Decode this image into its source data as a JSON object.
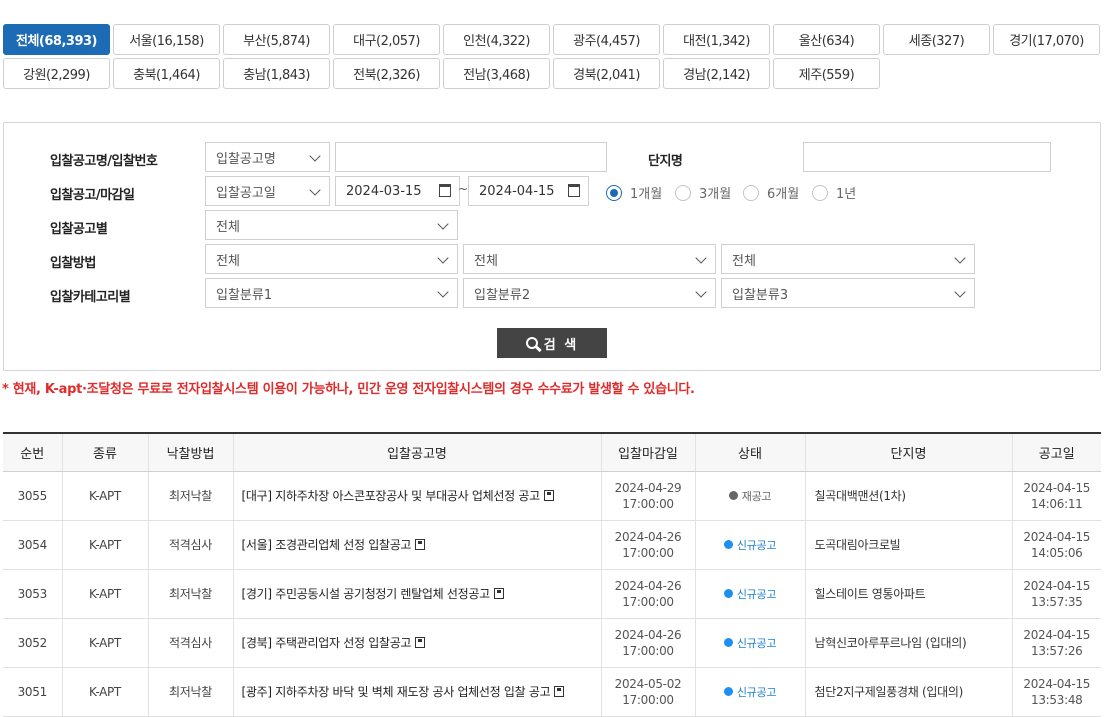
{
  "regions": [
    [
      "전체(68,393)",
      "서울(16,158)",
      "부산(5,874)",
      "대구(2,057)",
      "인천(4,322)",
      "광주(4,457)",
      "대전(1,342)",
      "울산(634)",
      "세종(327)",
      "경기(17,070)"
    ],
    [
      "강원(2,299)",
      "충북(1,464)",
      "충남(1,843)",
      "전북(2,326)",
      "전남(3,468)",
      "경북(2,041)",
      "경남(2,142)",
      "제주(559)"
    ]
  ],
  "search": {
    "label_name": "입찰공고명/입찰번호",
    "name_type": "입찰공고명",
    "label_complex": "단지명",
    "label_date": "입찰공고/마감일",
    "date_type": "입찰공고일",
    "date_from": "2024-03-15",
    "date_to": "2024-04-15",
    "tilde": "~",
    "periods": [
      "1개월",
      "3개월",
      "6개월",
      "1년"
    ],
    "label_notice": "입찰공고별",
    "notice_value": "전체",
    "label_method": "입찰방법",
    "method_values": [
      "전체",
      "전체",
      "전체"
    ],
    "label_category": "입찰카테고리별",
    "category_values": [
      "입찰분류1",
      "입찰분류2",
      "입찰분류3"
    ],
    "button": "검 색"
  },
  "notice": "* 현재, K-apt·조달청은 무료로 전자입찰시스템 이용이 가능하나, 민간 운영 전자입찰시스템의 경우 수수료가 발생할 수 있습니다.",
  "table": {
    "headers": [
      "순번",
      "종류",
      "낙찰방법",
      "입찰공고명",
      "입찰마감일",
      "상태",
      "단지명",
      "공고일"
    ],
    "rows": [
      {
        "no": "3055",
        "type": "K-APT",
        "method": "최저낙찰",
        "title": "[대구] 지하주차장 아스콘포장공사 및 부대공사 업체선정 공고",
        "deadline_date": "2024-04-29",
        "deadline_time": "17:00:00",
        "status": "재공고",
        "complex": "칠곡대백맨션(1차)",
        "posted_date": "2024-04-15",
        "posted_time": "14:06:11"
      },
      {
        "no": "3054",
        "type": "K-APT",
        "method": "적격심사",
        "title": "[서울] 조경관리업체 선정 입찰공고",
        "deadline_date": "2024-04-26",
        "deadline_time": "17:00:00",
        "status": "신규공고",
        "complex": "도곡대림아크로빌",
        "posted_date": "2024-04-15",
        "posted_time": "14:05:06"
      },
      {
        "no": "3053",
        "type": "K-APT",
        "method": "최저낙찰",
        "title": "[경기] 주민공동시설 공기청정기 렌탈업체 선정공고",
        "deadline_date": "2024-04-26",
        "deadline_time": "17:00:00",
        "status": "신규공고",
        "complex": "힐스테이트 영통아파트",
        "posted_date": "2024-04-15",
        "posted_time": "13:57:35"
      },
      {
        "no": "3052",
        "type": "K-APT",
        "method": "적격심사",
        "title": "[경북] 주택관리업자 선정 입찰공고",
        "deadline_date": "2024-04-26",
        "deadline_time": "17:00:00",
        "status": "신규공고",
        "complex": "남혁신코아루푸르나임 (입대의)",
        "posted_date": "2024-04-15",
        "posted_time": "13:57:26"
      },
      {
        "no": "3051",
        "type": "K-APT",
        "method": "최저낙찰",
        "title": "[광주] 지하주차장 바닥 및 벽체 재도장 공사 업체선정 입찰 공고",
        "deadline_date": "2024-05-02",
        "deadline_time": "17:00:00",
        "status": "신규공고",
        "complex": "첨단2지구제일풍경채 (입대의)",
        "posted_date": "2024-04-15",
        "posted_time": "13:53:48"
      }
    ]
  },
  "colors": {
    "accent": "#1d6bb5",
    "notice": "#e02b2b",
    "status_new": "#1d8ff0",
    "status_re": "#666666"
  },
  "icons": {
    "file": "save-icon",
    "calendar": "calendar-icon",
    "search": "search-icon"
  }
}
